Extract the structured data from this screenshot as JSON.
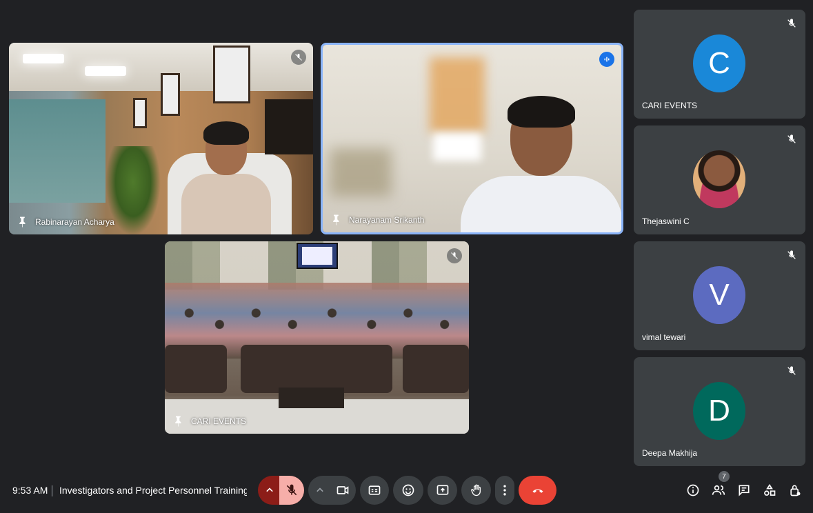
{
  "tiles": [
    {
      "id": "rabi",
      "name": "Rabinarayan Acharya",
      "muted": true
    },
    {
      "id": "nara",
      "name": "Narayanam Srikanth",
      "speaking": true
    },
    {
      "id": "cari",
      "name": "CARI EVENTS",
      "muted": true
    }
  ],
  "side_participants": [
    {
      "name": "CARI EVENTS",
      "initial": "C",
      "color": "#1a88d8"
    },
    {
      "name": "Thejaswini C",
      "initial": "",
      "color": "#e2b07a"
    },
    {
      "name": "vimal tewari",
      "initial": "V",
      "color": "#5c6bc0"
    },
    {
      "name": "Deepa Makhija",
      "initial": "D",
      "color": "#00695c"
    }
  ],
  "bottom_bar": {
    "time": "9:53 AM",
    "meeting_title": "Investigators and Project Personnel Training f...",
    "people_count": "7"
  },
  "icons": {
    "pin": "pin-icon",
    "mic_off": "mic-off-icon",
    "speaking": "speaking-icon",
    "camera": "camera-icon",
    "captions": "captions-icon",
    "emoji": "emoji-icon",
    "present": "present-icon",
    "hand": "raise-hand-icon",
    "more": "more-vert-icon",
    "leave": "call-end-icon",
    "info": "info-icon",
    "people": "people-icon",
    "chat": "chat-icon",
    "activities": "activities-icon",
    "host": "host-controls-icon"
  }
}
